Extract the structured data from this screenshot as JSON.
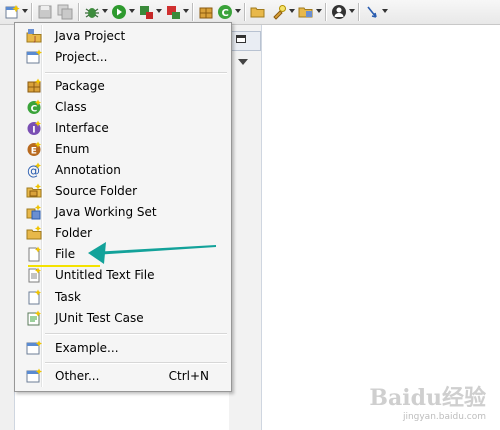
{
  "toolbar": {
    "buttons": [
      {
        "name": "new-wizard",
        "icon": "new-icon"
      },
      {
        "name": "save",
        "icon": "save-icon"
      },
      {
        "name": "save-all",
        "icon": "save-all-icon"
      },
      {
        "name": "debug",
        "icon": "bug-icon"
      },
      {
        "name": "run",
        "icon": "run-icon"
      },
      {
        "name": "external-tools",
        "icon": "external-tools-icon"
      },
      {
        "name": "coverage",
        "icon": "coverage-icon"
      },
      {
        "name": "new-package",
        "icon": "package-icon"
      },
      {
        "name": "new-class",
        "icon": "class-icon"
      },
      {
        "name": "open-type",
        "icon": "folder-open-icon"
      },
      {
        "name": "search",
        "icon": "flashlight-icon"
      },
      {
        "name": "open-task",
        "icon": "folder-task-icon"
      },
      {
        "name": "profile",
        "icon": "person-icon"
      },
      {
        "name": "next-annotation",
        "icon": "annotation-arrow-icon"
      }
    ]
  },
  "menu": {
    "items": [
      {
        "label": "Java Project",
        "icon": "java-project-icon"
      },
      {
        "label": "Project...",
        "icon": "project-icon"
      },
      {
        "label": "Package",
        "icon": "package-icon"
      },
      {
        "label": "Class",
        "icon": "class-icon"
      },
      {
        "label": "Interface",
        "icon": "interface-icon"
      },
      {
        "label": "Enum",
        "icon": "enum-icon"
      },
      {
        "label": "Annotation",
        "icon": "annotation-icon"
      },
      {
        "label": "Source Folder",
        "icon": "source-folder-icon"
      },
      {
        "label": "Java Working Set",
        "icon": "working-set-icon"
      },
      {
        "label": "Folder",
        "icon": "folder-icon"
      },
      {
        "label": "File",
        "icon": "file-icon"
      },
      {
        "label": "Untitled Text File",
        "icon": "text-file-icon"
      },
      {
        "label": "Task",
        "icon": "task-icon"
      },
      {
        "label": "JUnit Test Case",
        "icon": "junit-icon"
      },
      {
        "label": "Example...",
        "icon": "example-icon"
      },
      {
        "label": "Other...",
        "icon": "other-icon",
        "accelerator": "Ctrl+N"
      }
    ]
  },
  "watermark": {
    "main": "Baidu经验",
    "sub": "jingyan.baidu.com"
  },
  "colors": {
    "annotation_arrow": "#13a29a",
    "underline": "#f4e200"
  }
}
